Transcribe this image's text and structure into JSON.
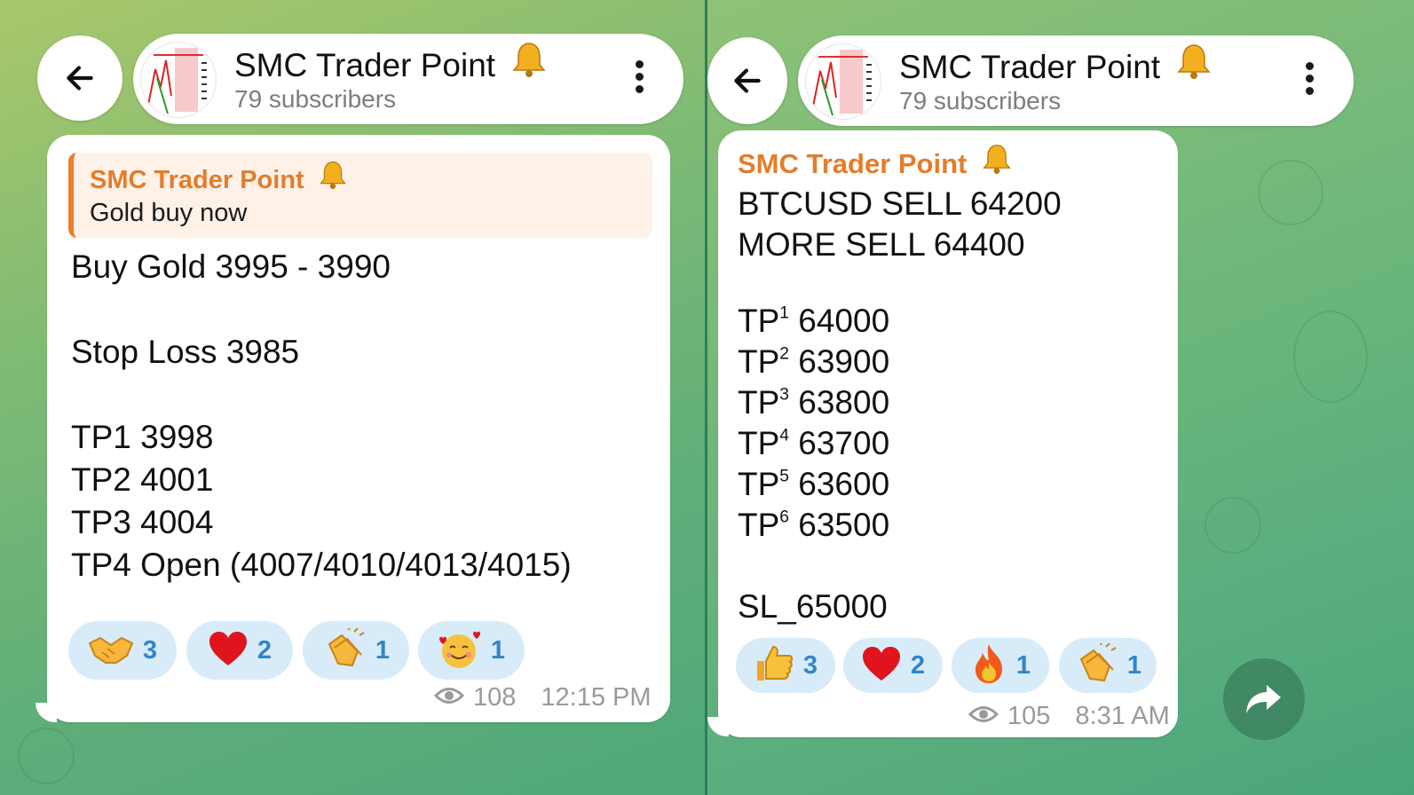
{
  "left": {
    "header": {
      "title": "SMC Trader Point",
      "subscribers": "79 subscribers"
    },
    "message": {
      "reply": {
        "sender": "SMC Trader Point",
        "text": "Gold buy now"
      },
      "lines": [
        "Buy Gold 3995 - 3990",
        "Stop Loss 3985",
        "TP1 3998",
        "TP2 4001",
        "TP3 4004",
        "TP4 Open (4007/4010/4013/4015)"
      ],
      "reactions": [
        {
          "icon": "handshake-emoji",
          "count": "3"
        },
        {
          "icon": "red-heart-emoji",
          "count": "2"
        },
        {
          "icon": "clapping-hands-emoji",
          "count": "1"
        },
        {
          "icon": "smiling-face-with-hearts-emoji",
          "count": "1"
        }
      ],
      "views": "108",
      "time": "12:15 PM"
    }
  },
  "right": {
    "header": {
      "title": "SMC Trader Point",
      "subscribers": "79 subscribers"
    },
    "message": {
      "sender": "SMC Trader Point",
      "lines": [
        "BTCUSD SELL 64200",
        "MORE SELL 64400"
      ],
      "tps": [
        {
          "label": "TP",
          "sup": "1",
          "value": "64000"
        },
        {
          "label": "TP",
          "sup": "2",
          "value": "63900"
        },
        {
          "label": "TP",
          "sup": "3",
          "value": "63800"
        },
        {
          "label": "TP",
          "sup": "4",
          "value": "63700"
        },
        {
          "label": "TP",
          "sup": "5",
          "value": "63600"
        },
        {
          "label": "TP",
          "sup": "6",
          "value": "63500"
        }
      ],
      "sl": "SL_65000",
      "reactions": [
        {
          "icon": "thumbs-up-emoji",
          "count": "3"
        },
        {
          "icon": "red-heart-emoji",
          "count": "2"
        },
        {
          "icon": "fire-emoji",
          "count": "1"
        },
        {
          "icon": "clapping-hands-emoji",
          "count": "1"
        }
      ],
      "views": "105",
      "time": "8:31 AM"
    }
  },
  "colors": {
    "accent_orange": "#e37d2b",
    "reaction_bg": "#d8ebf8",
    "reaction_count": "#2f86c9",
    "meta_gray": "#9a9a9a",
    "chat_green": "#6fb06c"
  }
}
